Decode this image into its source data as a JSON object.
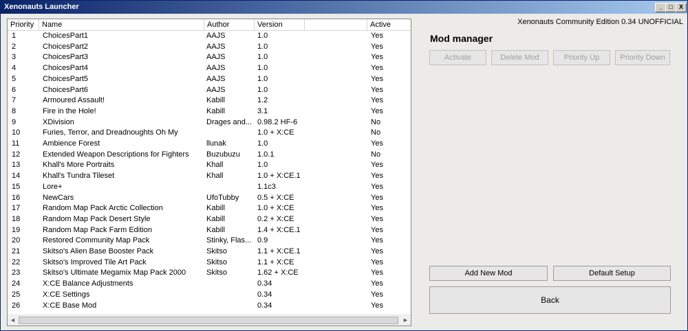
{
  "window": {
    "title": "Xenonauts Launcher"
  },
  "titlebar_buttons": {
    "minimize": "_",
    "maximize": "□",
    "close": "X"
  },
  "edition": "Xenonauts Community Edition 0.34 UNOFFICIAL",
  "mod_manager": {
    "title": "Mod manager",
    "buttons": {
      "activate": "Activate",
      "delete_mod": "Delete Mod",
      "priority_up": "Priority Up",
      "priority_down": "Priority Down",
      "add_new_mod": "Add New Mod",
      "default_setup": "Default Setup",
      "back": "Back"
    }
  },
  "columns": {
    "priority": "Priority",
    "name": "Name",
    "author": "Author",
    "version": "Version",
    "active": "Active"
  },
  "mods": [
    {
      "priority": "1",
      "name": "ChoicesPart1",
      "author": "AAJS",
      "version": "1.0",
      "active": "Yes"
    },
    {
      "priority": "2",
      "name": "ChoicesPart2",
      "author": "AAJS",
      "version": "1.0",
      "active": "Yes"
    },
    {
      "priority": "3",
      "name": "ChoicesPart3",
      "author": "AAJS",
      "version": "1.0",
      "active": "Yes"
    },
    {
      "priority": "4",
      "name": "ChoicesPart4",
      "author": "AAJS",
      "version": "1.0",
      "active": "Yes"
    },
    {
      "priority": "5",
      "name": "ChoicesPart5",
      "author": "AAJS",
      "version": "1.0",
      "active": "Yes"
    },
    {
      "priority": "6",
      "name": "ChoicesPart6",
      "author": "AAJS",
      "version": "1.0",
      "active": "Yes"
    },
    {
      "priority": "7",
      "name": "Armoured Assault!",
      "author": "Kabill",
      "version": "1.2",
      "active": "Yes"
    },
    {
      "priority": "8",
      "name": "Fire in the Hole!",
      "author": "Kabill",
      "version": "3.1",
      "active": "Yes"
    },
    {
      "priority": "9",
      "name": "XDivision",
      "author": "Drages and...",
      "version": "0.98.2 HF-6",
      "active": "No"
    },
    {
      "priority": "10",
      "name": "Furies, Terror, and Dreadnoughts Oh My",
      "author": "",
      "version": "1.0 + X:CE",
      "active": "No"
    },
    {
      "priority": "11",
      "name": "Ambience Forest",
      "author": "llunak",
      "version": "1.0",
      "active": "Yes"
    },
    {
      "priority": "12",
      "name": "Extended Weapon Descriptions for Fighters",
      "author": "Buzubuzu",
      "version": "1.0.1",
      "active": "No"
    },
    {
      "priority": "13",
      "name": "Khall's More Portraits",
      "author": "Khall",
      "version": "1.0",
      "active": "Yes"
    },
    {
      "priority": "14",
      "name": "Khall's Tundra Tileset",
      "author": "Khall",
      "version": "1.0 + X:CE.1",
      "active": "Yes"
    },
    {
      "priority": "15",
      "name": "Lore+",
      "author": "",
      "version": "1.1c3",
      "active": "Yes"
    },
    {
      "priority": "16",
      "name": "NewCars",
      "author": "UfoTubby",
      "version": "0.5 + X:CE",
      "active": "Yes"
    },
    {
      "priority": "17",
      "name": "Random Map Pack Arctic Collection",
      "author": "Kabill",
      "version": "1.0 + X:CE",
      "active": "Yes"
    },
    {
      "priority": "18",
      "name": "Random Map Pack Desert Style",
      "author": "Kabill",
      "version": "0.2 + X:CE",
      "active": "Yes"
    },
    {
      "priority": "19",
      "name": "Random Map Pack Farm Edition",
      "author": "Kabill",
      "version": "1.4 + X:CE.1",
      "active": "Yes"
    },
    {
      "priority": "20",
      "name": "Restored Community Map Pack",
      "author": "Stinky, Flas...",
      "version": "0.9",
      "active": "Yes"
    },
    {
      "priority": "21",
      "name": "Skitso's Alien Base Booster Pack",
      "author": "Skitso",
      "version": "1.1 + X:CE.1",
      "active": "Yes"
    },
    {
      "priority": "22",
      "name": "Skitso's Improved Tile Art Pack",
      "author": "Skitso",
      "version": "1.1 + X:CE",
      "active": "Yes"
    },
    {
      "priority": "23",
      "name": "Skitso's Ultimate Megamix Map Pack 2000",
      "author": "Skitso",
      "version": "1.62 + X:CE",
      "active": "Yes"
    },
    {
      "priority": "24",
      "name": "X:CE Balance Adjustments",
      "author": "",
      "version": "0.34",
      "active": "Yes"
    },
    {
      "priority": "25",
      "name": "X:CE Settings",
      "author": "",
      "version": "0.34",
      "active": "Yes"
    },
    {
      "priority": "26",
      "name": "X:CE Base Mod",
      "author": "",
      "version": "0.34",
      "active": "Yes"
    }
  ],
  "scrollbar": {
    "left_arrow": "◄",
    "right_arrow": "►"
  }
}
